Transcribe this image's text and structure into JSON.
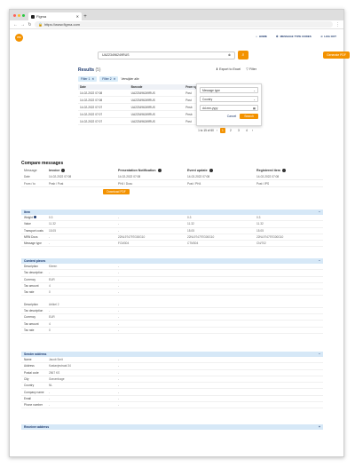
{
  "browser": {
    "tab_title": "Figma",
    "url": "https://www.figma.com",
    "colors": {
      "close": "#ff5f57",
      "min": "#febc2e",
      "max": "#28c840"
    }
  },
  "header": {
    "logo_text": "PN",
    "nav": [
      {
        "icon": "home-icon",
        "label": "HOME"
      },
      {
        "icon": "code-icon",
        "label": "MESSAGE TYPE CODES"
      },
      {
        "icon": "logout-icon",
        "label": "LOG OUT"
      }
    ]
  },
  "search": {
    "value": "UA223496249RUS",
    "generate_label": "Generate PDF"
  },
  "results": {
    "title": "Results",
    "count": "(5)",
    "export_label": "Export to Excel",
    "filter_label": "Filter",
    "chips": [
      "Filter 1",
      "Filter 2"
    ],
    "chip_extra": "Verwijder alle",
    "columns": [
      "Date",
      "Barcode",
      "From system",
      "To system"
    ],
    "rows": [
      [
        "14-02-2022 07:08",
        "UA223496249RUS",
        "Post",
        "BIP"
      ],
      [
        "14-02-2022 07:08",
        "UA223496249RUS",
        "Post",
        "Docu"
      ],
      [
        "14-02-2022 07:07",
        "UA223496249RUS",
        "Pnsb",
        "IPS"
      ],
      [
        "14-02-2022 07:07",
        "UA223496249RUS",
        "Pnsb",
        "IPS"
      ],
      [
        "14-02-2022 07:07",
        "UA223496249RUS",
        "Post",
        "Docu"
      ]
    ],
    "pager": {
      "info": "1 to 15 of 60",
      "pages": [
        "1",
        "2",
        "3",
        "4"
      ]
    }
  },
  "filter_popup": {
    "fields": [
      "Message type",
      "Country",
      "dd-mm-yyyy"
    ],
    "cancel": "Cancel",
    "search": "Search"
  },
  "compare": {
    "title": "Compare messages",
    "columns": [
      "Message",
      "Invoice",
      "Presentation Notification",
      "Event update",
      "Registered item"
    ],
    "rows": [
      [
        "Date",
        "14-02-2022 07:08",
        "14-02-2022 07:08",
        "14-02-2022 07:08",
        "14-02-2022 07:08"
      ],
      [
        "From / to",
        "Pnsb / Post",
        "PH4 / Docu",
        "Post / PH4",
        "Post / IPS"
      ]
    ],
    "download_label": "Download PDF"
  },
  "sections": [
    {
      "title": "Item",
      "rows": [
        [
          "Weight",
          "0.3",
          "-",
          "0.3",
          "0.3"
        ],
        [
          "Value",
          "11.32",
          "-",
          "11.32",
          "11.32"
        ],
        [
          "Transport costs",
          "15.05",
          "-",
          "15.05",
          "15.05"
        ],
        [
          "MRN Docs",
          "-",
          "22NL974797G00G10",
          "22NL974797G00G10",
          "22NL974797G00G10"
        ],
        [
          "Message type",
          "-",
          "FCM304",
          "CTM304",
          "CN/702"
        ]
      ]
    },
    {
      "title": "Content pieces",
      "rows": [
        [
          "Description",
          "Kleren",
          "-"
        ],
        [
          "Tax description",
          "-",
          "-"
        ],
        [
          "Currency",
          "EUR",
          "-"
        ],
        [
          "Tax amount",
          "4",
          "-"
        ],
        [
          "Tax rate",
          "0",
          "-"
        ],
        [
          "Description",
          "Artikel 2",
          "-"
        ],
        [
          "Tax description",
          "-",
          "-"
        ],
        [
          "Currency",
          "EUR",
          "-"
        ],
        [
          "Tax amount",
          "4",
          "-"
        ],
        [
          "Tax rate",
          "0",
          "-"
        ]
      ]
    },
    {
      "title": "Sender address",
      "rows": [
        [
          "Name",
          "Jacob Smit",
          "-"
        ],
        [
          "Address",
          "Kastanjestraat 34",
          "-"
        ],
        [
          "Postal code",
          "2567 KS",
          "-"
        ],
        [
          "City",
          "Gravenhage",
          "-"
        ],
        [
          "Country",
          "NL",
          "-"
        ],
        [
          "Company name",
          "-",
          "-"
        ],
        [
          "Email",
          "-",
          "-"
        ],
        [
          "Phone number",
          "-",
          "-"
        ]
      ]
    },
    {
      "title": "Receiver address",
      "rows": []
    }
  ]
}
